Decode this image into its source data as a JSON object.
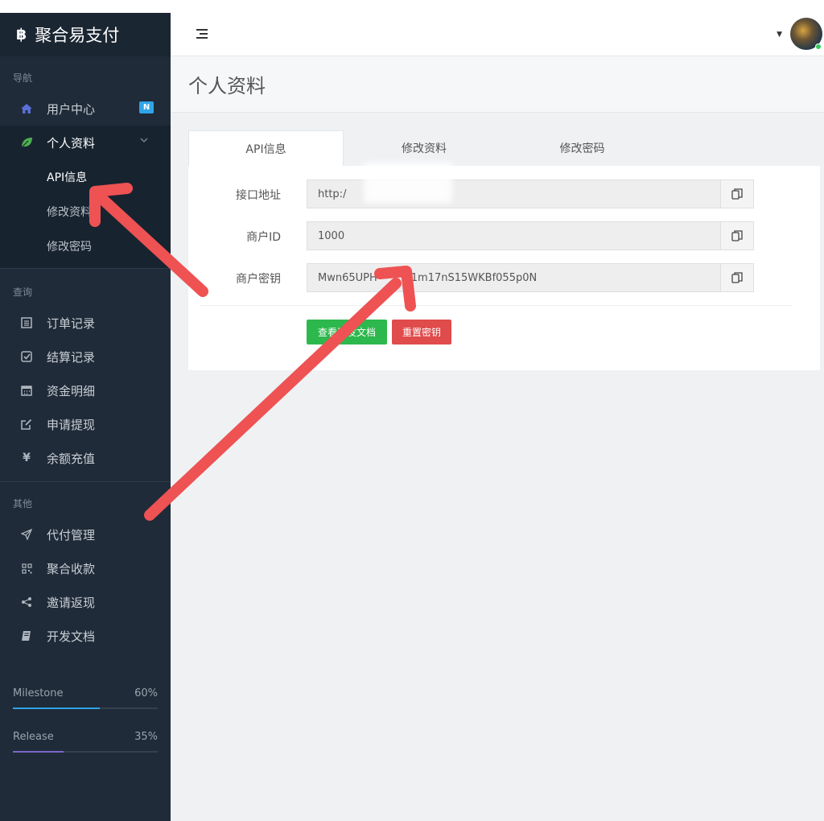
{
  "brand": {
    "icon": "bitcoin-icon",
    "title": "聚合易支付"
  },
  "sidebar": {
    "section_nav": "导航",
    "section_query": "查询",
    "section_other": "其他",
    "items": {
      "user_center": {
        "label": "用户中心",
        "icon": "home-icon",
        "badge": "N"
      },
      "profile": {
        "label": "个人资料",
        "icon": "leaf-icon"
      },
      "orders": {
        "label": "订单记录",
        "icon": "list-icon"
      },
      "settlements": {
        "label": "结算记录",
        "icon": "check-square-icon"
      },
      "funds": {
        "label": "资金明细",
        "icon": "calendar-icon"
      },
      "withdraw": {
        "label": "申请提现",
        "icon": "edit-icon"
      },
      "recharge": {
        "label": "余额充值",
        "icon": "yen-icon"
      },
      "payout": {
        "label": "代付管理",
        "icon": "send-icon"
      },
      "collect": {
        "label": "聚合收款",
        "icon": "qrcode-icon"
      },
      "invite": {
        "label": "邀请返现",
        "icon": "share-icon"
      },
      "docs": {
        "label": "开发文档",
        "icon": "book-icon"
      }
    },
    "profile_sub": {
      "api": "API信息",
      "edit": "修改资料",
      "password": "修改密码"
    },
    "progress": [
      {
        "label": "Milestone",
        "percent_text": "60%",
        "value": 0.6,
        "color": "#2fa4e7"
      },
      {
        "label": "Release",
        "percent_text": "35%",
        "value": 0.35,
        "color": "#7b68c9"
      }
    ]
  },
  "header": {
    "menu_icon": "menu-toggle-icon",
    "avatar_icon": "user-avatar"
  },
  "page": {
    "title": "个人资料",
    "tabs": [
      "API信息",
      "修改资料",
      "修改密码"
    ],
    "form": {
      "api_url": {
        "label": "接口地址",
        "value": "http:/"
      },
      "merchant_id": {
        "label": "商户ID",
        "value": "1000"
      },
      "merchant_key": {
        "label": "商户密钥",
        "value": "Mwn65UPH",
        "value_tail": "1m17nS15WKBf055p0N"
      }
    },
    "buttons": {
      "docs": "查看开发文档",
      "reset_key": "重置密钥"
    }
  },
  "colors": {
    "sidebar_bg": "#1f2b38",
    "green": "#2db84d",
    "red": "#e04b4b",
    "arrow": "#ee5253"
  }
}
